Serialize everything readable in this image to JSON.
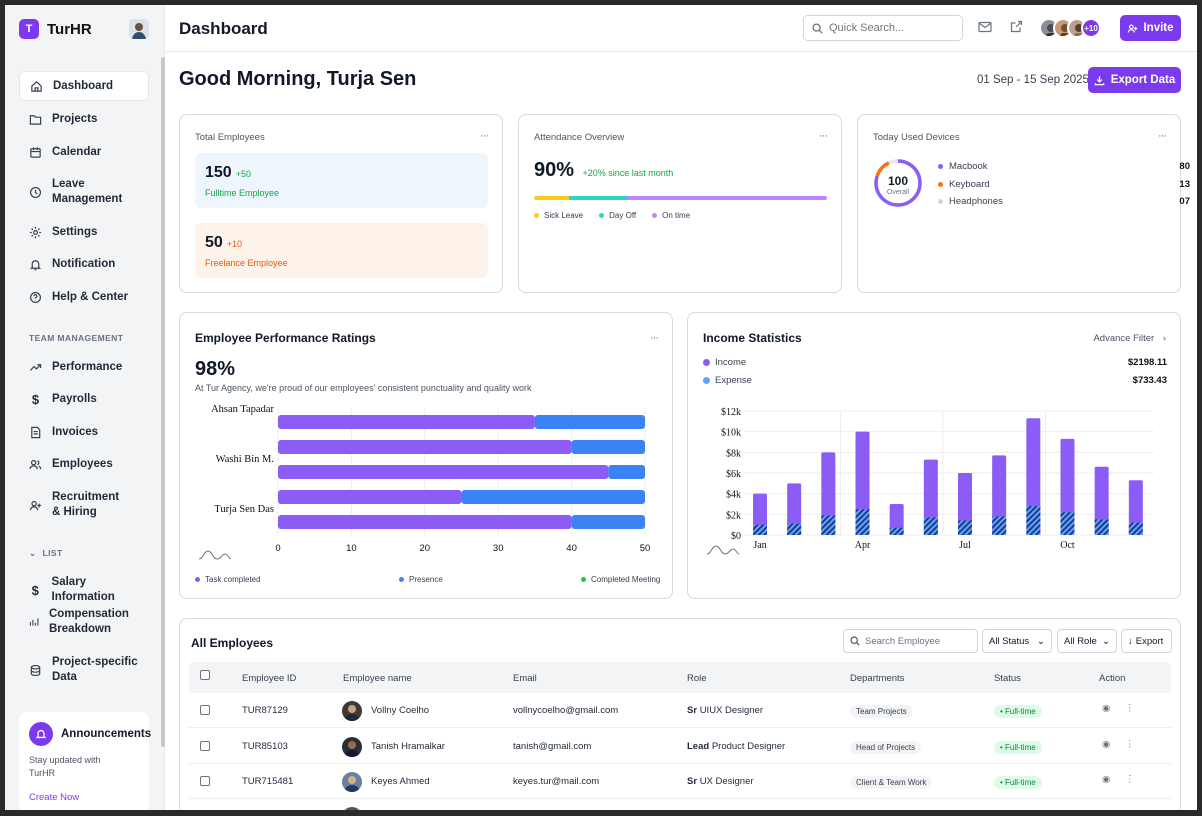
{
  "brand": {
    "logo_letter": "T",
    "name": "TurHR"
  },
  "sidebar": {
    "items": [
      {
        "label": "Dashboard",
        "icon": "home-icon"
      },
      {
        "label": "Projects",
        "icon": "folder-icon"
      },
      {
        "label": "Calendar",
        "icon": "calendar-icon"
      },
      {
        "label": "Leave Management",
        "icon": "clock-icon"
      },
      {
        "label": "Settings",
        "icon": "gear-icon"
      },
      {
        "label": "Notification",
        "icon": "bell-icon"
      },
      {
        "label": "Help & Center",
        "icon": "help-icon"
      }
    ],
    "team_section": "TEAM MANAGEMENT",
    "team_items": [
      {
        "label": "Performance",
        "icon": "trend-icon"
      },
      {
        "label": "Payrolls",
        "icon": "dollar-icon"
      },
      {
        "label": "Invoices",
        "icon": "invoice-icon"
      },
      {
        "label": "Employees",
        "icon": "users-icon"
      },
      {
        "label": "Recruitment & Hiring",
        "icon": "user-plus-icon"
      }
    ],
    "list_section": "LIST",
    "list_items": [
      {
        "label": "Salary Information",
        "icon": "dollar-icon"
      },
      {
        "label": "Compensation Breakdown",
        "icon": "bar-icon"
      },
      {
        "label": "Project-specific Data",
        "icon": "database-icon"
      }
    ],
    "announcement": {
      "title": "Announcements",
      "text": "Stay updated with TurHR",
      "link": "Create Now"
    }
  },
  "header": {
    "title": "Dashboard",
    "search_placeholder": "Quick Search...",
    "avatar_more": "+10",
    "invite": "Invite"
  },
  "main": {
    "greeting": "Good Morning, Turja Sen",
    "date_range": "01 Sep - 15 Sep 2025",
    "export_label": "Export Data"
  },
  "cards": {
    "total": {
      "title": "Total Employees",
      "full_count": "150",
      "full_delta": "+50",
      "full_label": "Fulltime Employee",
      "free_count": "50",
      "free_delta": "+10",
      "free_label": "Freelance Employee"
    },
    "attendance": {
      "title": "Attendance Overview",
      "value": "90%",
      "delta": "+20% since last month",
      "segments": [
        {
          "label": "Sick Leave",
          "pct": 12,
          "color": "#facc15"
        },
        {
          "label": "Day Off",
          "pct": 20,
          "color": "#2dd4bf"
        },
        {
          "label": "On time",
          "pct": 68,
          "color": "#c084fc"
        }
      ]
    },
    "devices": {
      "title": "Today Used Devices",
      "total": "100",
      "total_label": "Overall",
      "items": [
        {
          "name": "Macbook",
          "value": "80",
          "color": "#8b5cf6"
        },
        {
          "name": "Keyboard",
          "value": "13",
          "color": "#f97316"
        },
        {
          "name": "Headphones",
          "value": "07",
          "color": "#d1d5db"
        }
      ]
    }
  },
  "performance": {
    "title": "Employee Performance Ratings",
    "value": "98%",
    "subtitle": "At Tur Agency, we're proud of our employees' consistent punctuality and quality work",
    "legend": [
      "Task completed",
      "Presence",
      "Completed Meeting"
    ]
  },
  "income": {
    "title": "Income Statistics",
    "filter": "Advance Filter",
    "income_label": "Income",
    "income_value": "$2198.11",
    "expense_label": "Expense",
    "expense_value": "$733.43"
  },
  "chart_data": [
    {
      "type": "bar",
      "orientation": "horizontal",
      "categories": [
        "Ahsan Tapadar",
        "",
        "Washi Bin M.",
        "",
        "Turja Sen Das"
      ],
      "series": [
        {
          "name": "Task completed",
          "values": [
            35,
            40,
            45,
            25,
            40
          ],
          "color": "#8b5cf6"
        },
        {
          "name": "Presence",
          "values": [
            15,
            10,
            5,
            25,
            10
          ],
          "color": "#3b82f6"
        }
      ],
      "xticks": [
        "0",
        "10",
        "20",
        "30",
        "40",
        "50"
      ],
      "xlim": [
        0,
        50
      ]
    },
    {
      "type": "bar",
      "x": [
        "Jan",
        "",
        "",
        "Apr",
        "",
        "",
        "Jul",
        "",
        "",
        "Oct",
        "",
        ""
      ],
      "series": [
        {
          "name": "Income",
          "values": [
            4000,
            5000,
            8000,
            10000,
            3000,
            7300,
            6000,
            7700,
            11300,
            9300,
            6600,
            5300
          ],
          "color": "#8b5cf6"
        },
        {
          "name": "Expense",
          "values": [
            1000,
            1100,
            1900,
            2500,
            700,
            1700,
            1400,
            1800,
            2800,
            2200,
            1500,
            1200
          ],
          "color": "#1e40af"
        }
      ],
      "yticks": [
        "$0",
        "$2k",
        "$4k",
        "$6k",
        "$8k",
        "$10k",
        "$12k"
      ],
      "ylim": [
        0,
        12000
      ],
      "grid": true
    }
  ],
  "employees": {
    "title": "All Employees",
    "search_placeholder": "Search Employee",
    "status_filter": "All Status",
    "role_filter": "All Role",
    "export": "Export",
    "columns": [
      "Employee ID",
      "Employee name",
      "Email",
      "Role",
      "Departments",
      "Status",
      "Action"
    ],
    "rows": [
      {
        "id": "TUR87129",
        "name": "Vollny Coelho",
        "email": "vollnycoelho@gmail.com",
        "role_level": "Sr",
        "role": "UIUX Designer",
        "dept": "Team Projects",
        "status": "• Full-time"
      },
      {
        "id": "TUR85103",
        "name": "Tanish Hramalkar",
        "email": "tanish@gmail.com",
        "role_level": "Lead",
        "role": "Product Designer",
        "dept": "Head of Projects",
        "status": "• Full-time"
      },
      {
        "id": "TUR715481",
        "name": "Keyes Ahmed",
        "email": "keyes.tur@mail.com",
        "role_level": "Sr",
        "role": "UX Designer",
        "dept": "Client & Team Work",
        "status": "• Full-time"
      }
    ]
  },
  "colors": {
    "accent": "#7c3aed",
    "purple": "#8b5cf6",
    "blue": "#3b82f6"
  }
}
